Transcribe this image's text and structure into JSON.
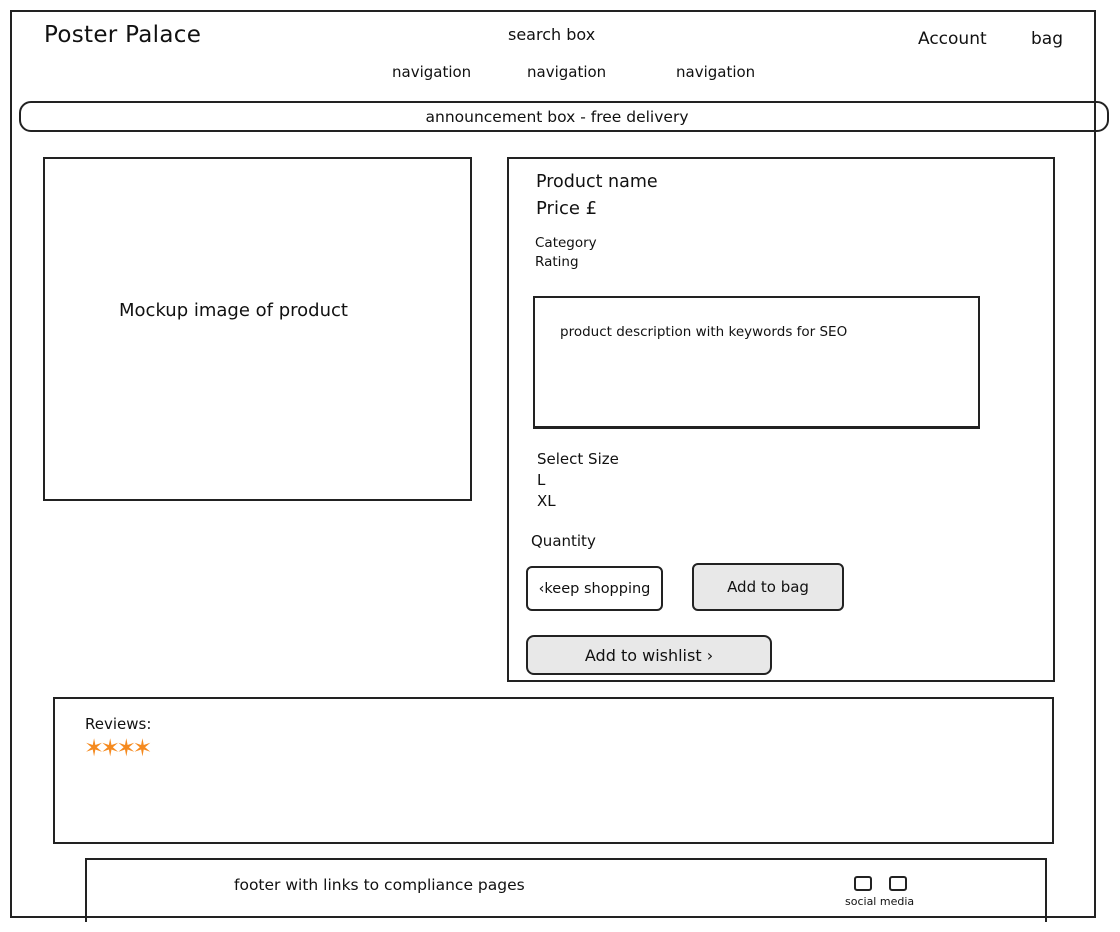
{
  "header": {
    "logo": "Poster Palace",
    "search": "search box",
    "account": "Account",
    "bag": "bag",
    "nav": [
      "navigation",
      "navigation",
      "navigation"
    ]
  },
  "announcement": "announcement box - free delivery",
  "product": {
    "image_label": "Mockup image of product",
    "name": "Product name",
    "price": "Price £",
    "category": "Category",
    "rating": "Rating",
    "description": "product description with keywords for SEO",
    "size_label": "Select Size",
    "sizes": [
      "L",
      "XL"
    ],
    "quantity_label": "Quantity",
    "keep_shopping": "‹keep shopping",
    "add_to_bag": "Add to bag",
    "add_to_wishlist": "Add to wishlist ›"
  },
  "reviews": {
    "label": "Reviews:",
    "stars": "✶✶✶✶",
    "star_color": "#f58a1f"
  },
  "footer": {
    "text": "footer with links to compliance pages",
    "social_label": "social media",
    "social_icons": [
      "social-icon",
      "social-icon"
    ]
  }
}
